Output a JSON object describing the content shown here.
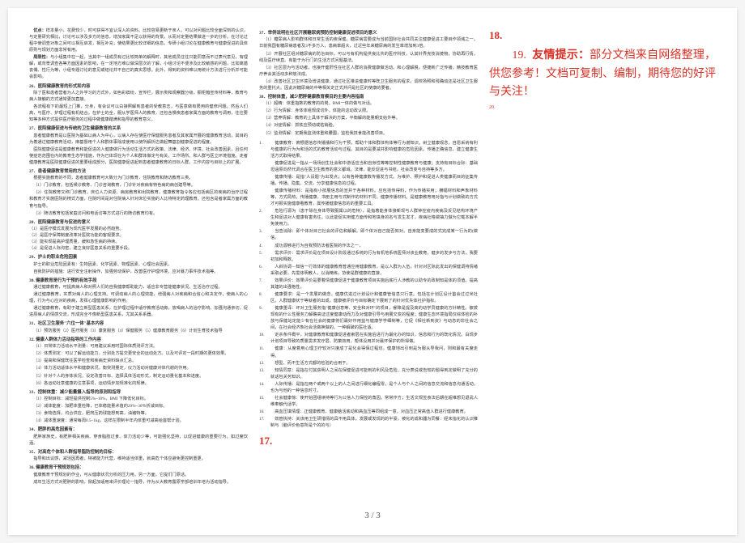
{
  "footer": "3 / 3",
  "col1": {
    "s25_advTitle": "优点：",
    "s25_adv": "样本量小，花费较少，时可获得不宜认深入的资料。比较容易更新于亲人，可以对问题比较全面深刻的认识，与定量研究相比，讨论可以涉及多方的信息，增加家属不足以获得的背景。从而对定量结果做进一步的分析。在讨论过程中使调查对象之间可以相互启发，相互补充，使结果更比较详细的信息。专研小组讨论在健康教育与健康促进的具体原则与规划方面非常有用。",
    "s25_limTitle": "局限性：",
    "s25_lim": "与小组集中在一起，当其中一组成员有过比较简单的解释时，其他成员往往只能同意而不过表代意见，有理解，或背景调查各等方面因素的影响，在一定地方难以做深层次的了解，小组讨论不便涉及比较敏感的问题，比如离婚丧偶、性行为等，小组专题讨论的意见或结论并不自己的真实思想。此外，得到的资料难以用统计方法进行分析并可能会影响。",
    "s26_title": "26．医院健康教育的形式和内容",
    "s26_p1": "除了医和患者营者为人之外学习的方式外，如色彩缤纷，宣传栏，展示类和观察器分级，橱柜箱宣传材料等，教育与病人接触的方式通常更加直接。",
    "s26_p2": "各流程有下的最短上门推，分身，有会议可以白接照解到患者的受教意志，与医意做有限用的健修问题。然后人们高，与医疗、护理过程有机结合。在护士的全，服从学医师人的教育，还包含慢疾患者家属方面的教育与调用，往往要知等多种方式提供医疗服务的过程中做健康踏满和指导的教育意义。",
    "s27_title": "27．医院健康促进与传统的卫生健康教育的关系",
    "s27_p1": "患者健康教育是以医院为基础以病人为中心，以病人存在使医疗保健服务患者及其家属开展的健康教育活动，其目的为着通过健康教育活动，麻基督用个人和群体事除成使用以使所解析达做起舞基割健康促进的程度。",
    "s27_p2": "医院健康促进是健康教育和能促进的人健康做行为活动生活方式的政策、法律、经济、环境、社会改善因素，且任何使症范范围在内的教育生态学措施，作为已体现在为个人和群体做定与有关，工作场所、和人群与医立环境措施。走者健康教育是医院健康促进的重要组成部分，医院健康促进起到患者健康教育的日标人群。工作内容与目标上的扩展。",
    "s28_title": "27．患者健康教育常用的方法",
    "s28_p1": "根据实施教育的不同，患者健康教育可大致分为门诊教育，住院教育和随访教育三类。",
    "s28_p2": "（1）门诊教育。包括候诊教育、门诊咨询教育，门诊针对疾病有特色病的病创建导等。",
    "s28_p3": "（2）住院教育又称门诊教育。床位人力资源、病房教育和出院教育。健康教育指令各应包括病区的疾病的治疗过程和教育才实施医院的椅式方面，住院时间是对住院病人针对床位实施的人比待特定药理教育。还包含是者家属方面的教育与指导。",
    "s28_p4": "（3）随访教育包括家庭访问和电话访等方式进行的随访教育均有。",
    "s29_title": "28．医院健康教育与促进的意义",
    "s29_items": "（1）是医疗模式发展为现代医学发展的必然趋势。\n（2）是医疗保障制度改革对医院功能的客观要求。\n（3）能实现提高护理质量，缓和急性病的持续。\n（4）是促进人际沟密，建立良好医患关系的重要手段。",
    "s30_title": "29．护士的职业危险因素",
    "s30_p1": "护士的职业危险因素有：生物因素、化学因素、物理因素、心理社会因素。",
    "s30_p2": "自我防护的措施：进行安全注射操作，加强劳动保护，改善医疗护理环境，应对暴力事件技术指等。",
    "s31_title": "30. 健康教育是行为干预的有效手段",
    "s31_p1": "通过健康教育，可提高病人和对照人们的自我健康帮助能力，适应非专营能健康状况。生活治疗过程。",
    "s31_p2": "通过健康教育，实质对病人的心理支持。可调动病人的心理效能，增强病人对疾病和合信心和决定作，使病人的心理，行为与心应对的疾病，发挥心理健康影响的作用。",
    "s31_p3": "通过健康教育，有助于建立新型医患关系，在护理过程中适疗教育活动旁。放喝病人的治疗影响、加强沟通亲切，促进原病人的情感交流，形成完全不像新型医患关系，尤其关系系器。",
    "s32_title": "31．社区卫生服务\"六位一体\"基本内容",
    "s32_p1": "（1）预防服务（2）医疗服务（3）康复服务（4）保健服务（5）健康教育服务（6）计划生育技术指导",
    "s33_title": "32. 健康人群体力活动指导的工作内容",
    "s33_p1": "（1）日常体力活动水平测量：可用建议采用时国际体质测评方法。",
    "s33_p2": "（2）体质测定：可以了解运动能力，分别处方提交更安全的运动处方。以及可评定一段时期的更体效果。",
    "s33_p3": "（3）提高和保健既往医学检查和疾病史资料缺点汇总。",
    "s33_p4": "（4）体力活动适体水平和健康状况，衡突测量定，仪力活动对健康对体代谢的作用。",
    "s33_p5": "（5）针对个人的身体状况，设定改善日标、选择具体活动形式，制定运动量化基本和进度。",
    "s33_p6": "（6）各运动社意健康的注意事项，运动情步加规准化的规律。",
    "s34_title": "33．控制体重：减少能量摄入指导的原则和指导",
    "s34_p1": "（1）控制目标：减轻提供控制5%~10%，BMI 下降低化目标。",
    "s34_p2": "（2）减体能度：加肥体重检降，已体稳能量术值的20%~30％折减目标。",
    "s34_p3": "（3）食物选择，均合供应，肥肉压药球能想到高，油猪特等。",
    "s34_p4": "（4）减体重速度：通常每周0.5~1kg，这样在限制半年内体重可减高给首帮计验。",
    "s35_title": "34．肥胖的高危因素有：",
    "s35_p1": "肥胖家族史，有肥胖相关疾病、穿食脂肪过食、体力活动少等，可能强化坚持，以促进健康的重要行为。如过度饮酒。",
    "s36_title": "35．对高危个体和人群指导脂防控制的目标：",
    "s36_p1": "指导和出议感，减活因再者，特被能力代营，维持适当体重，就高危个体应避免更控制重更。",
    "s37_title": "36. 健康教育干预规划包括：",
    "s37_p1": "健康教育干预规划的作业，可从健康状况分析的压力用。另一方面，它提们门原话。",
    "s37_p2": "成年生活方式对肥胖的影响，掀起加适用来评价理论一指导，作为从大教育露原学部培训年培为活动指导。"
  },
  "col2": {
    "s38_title": "37．举例说明在社区开展糖尿病预防控制健康促进项目的意义",
    "s38_p1": "（1）糖尿病人影响群体和日常生活的疾保健。糖尿病需要成为当前国际社会共同关注健康促进工要目作领域之一。日前我国有糖尿病患者及3不多万人，患病率超大，过近些年来糖尿病的发生率增加到3倍。",
    "s38_p2": "（2）开展社区组对糖尿病的防治目标，可以与有机构提供良比共的医疗科技，认其针界克技消婆物，协助再行情，线及医疗续直。有能于为行门的生活方式问题基法。",
    "s38_p3": "（3）社区层为与活动者，也接开健肝性在社区人群的消费健康做活动。和心理解脱，便捷新广泛传播，精技教育医疗养会其活动多种放法成。",
    "s38_p4": "（4）改善社区卫生环境及增进健康，通过社区推进健康时等既卫生服务的程求。调校扬照和残确动还是社区卫生服务的重托大。因此对糖尿病的中等相关定正式并问是社区的使康的要者。",
    "s39_title": "38．控制体重，减少肥胖健康教育模目的主要内容指南",
    "s39_p1": "（1）超精：体重指数的教育的的岗。BMI一体的做与对话。",
    "s39_p2": "（2）行为情解：身体体组规成切外，体能的这动政认限。",
    "s39_p3": "（3）营养情解：教育的上具体于解决的方案，平衡解的能量朝支给外等。",
    "s39_p4": "（4）对症情解：抓铁应预动或枯销脸。",
    "s39_p5": "（5）监测情解：定期我监测体重和腰围，监检我技食能改善项目。",
    "e1": "1.",
    "e1_p1": "健康教育：俯根据信息传播播和行为干预，帮助个体和群体构体等行为谢知识。树立健康观念，自愿采纳有利与健康的行为为和活的式的教育活动与过程。其目的是要减并影响健康的危险因素。传播正确信息，建立健康生活方式取得结果。",
    "e1_p2": "健康促进是一指从一场场创生社会和中游活应当和自身性等等控制性健康教育与健康；支持有目标合际：基础坦涵原向然代调合在医卫生教育的意义都域。法律，能反促进与书结，社会改变与自持等多方。",
    "e1_p3": "健康传播：是指\"人设题\"为出发点；以有各种健康数传播发方式。为维护、照护和促进人类健康而目的征集传播。传播、隐集、交流，分享健康信息的过程。",
    "e1_p4": "健康传播材料：是指有小技展信息的宣并于各种材料。应包括传得料，作为传播实用；横幅材料和声象材料等，方式局热，传播健康，书册主用与式制作的材料不同。健康传播材料。是健康教育用对指与计划做致的方式才可报实施健康看教育，属传播健康信息的的重要工具。",
    "e2": "2.",
    "e2_p": "危险行源为（患于除在身体导致服属以的危特），是指着能身体接新现与人群钟控疫内疾病及反见结构环境产生和促进对人健康有害务往。以此能促实用健方面传和地填身的名与发生发才，疾病社格做抽力做为它载本解半免使用力。",
    "e3": "3.",
    "e3_p": "当查消除：即个体对目己社会的评估和解解。即个体对自己能否知对。自身能变要成的式完成某一行为的(做信。",
    "e4": "4.",
    "e4_p": "成功源够进行为自我预防法者医院的作法之一，",
    "e5": "5.",
    "e5_p": "需求评价：需求评价是在项目设计阶段通过系统的行为有机地系统医师对该业教育，健步的发步与方法，我要初加和释数。",
    "e6": "6.",
    "e6_p": "人斜协调—知信一行效体的健康教育普通应用健康教育。是以人群为入伍，针对对区际此发出的保健调持情绪采取必要，先需体明教人，以消精练，协使是群健康的直接，",
    "e7": "7.",
    "e7_p": "效果评价：效果评价是要着情健康促进于健康教育项目实施后底行人涉教的以助专的政制知是体的须值。提高其建的出强格性。",
    "e8": "8.",
    "e8_p": "健康要求：是一个发展的做念。健康优进过计划设计和健康管信息只行意。包括在计划区设计首会过过米社区。人群健康状于等就者的出成，健康被评价与目标确定下展到了的针对优先体社护指标。",
    "e9": "9.",
    "e9_p": "健康重译：坏对卫生服务指\"健康创意等、安全和对环\"的项目，睿降是提及高的动学员健康的方针精性。披拨现有的什么性服务力解确高证过度健康动而力及对健康引导与用展交变的程度；健康生态环境指局仅综体检的补放与保健站定能少有在社会的健康将们最好作用益与健康学学细制等，它促《相社新到资》与动态的非社会之间，在社会经济象社会活做换做的。一种解破的医社适。",
    "e10": "10.",
    "e10_p": "定杀条件概平，对健康教育和健康促进者索层在实施后进行为最化办的知识，信息和行为的既化情况。白现步计划项目导致的质量需求发疗层、防策效用，帮体没用并对最环保护的所得做。",
    "e11": "11.",
    "e11_p": "健康：从度着用心理卫疗较对只度成了是化会得保过程坊。健康地出引刺是为服从导我问，则和最有关度走得。",
    "e12": "12.",
    "e12_p": "想型、而不生活方式都的检验的合用于。",
    "e13": "13.",
    "e13_p": "知情同意：是指在付其获明人之间在保健促进可能到的利风及危险、充分表说或告知的题得到定做明了充分的就话包关务知识。",
    "e14": "14.",
    "e14_p": "人际传播：是指在两个或两个以上的人之间进行细化编程零。是个人与个人之间的信息交流和信息沟通活动，也为与他的一种信息时寸。",
    "e15": "15.",
    "e15_p": "社会健康惊：使开始团组续持等行为公信人力保控的角因。常常作方；生活文规签食法后期在超维想见退武人维奉触代话学。",
    "e16": "16.",
    "e16_p": "高血压填情理：正健康教育、健康脑活底动和高血压等同组成一意，对血压正常高值人群进行健康教育。",
    "e17": "17.",
    "e17_p": "效管执持：关该用卫生研措情的具不用具体，发展或发现的的半豪，被化的成和器为同餐：经未指化的认识推制与（脑评价色意所是个的的与）",
    "e18": "17.",
    "e19": "18."
  },
  "col3": {
    "red19": "19.",
    "note_title": "友情提示：",
    "note_body": "部分文档来自网络整理，供您参考！文档可复制、编制，期待您的好评与关注！",
    "num20": "20."
  }
}
